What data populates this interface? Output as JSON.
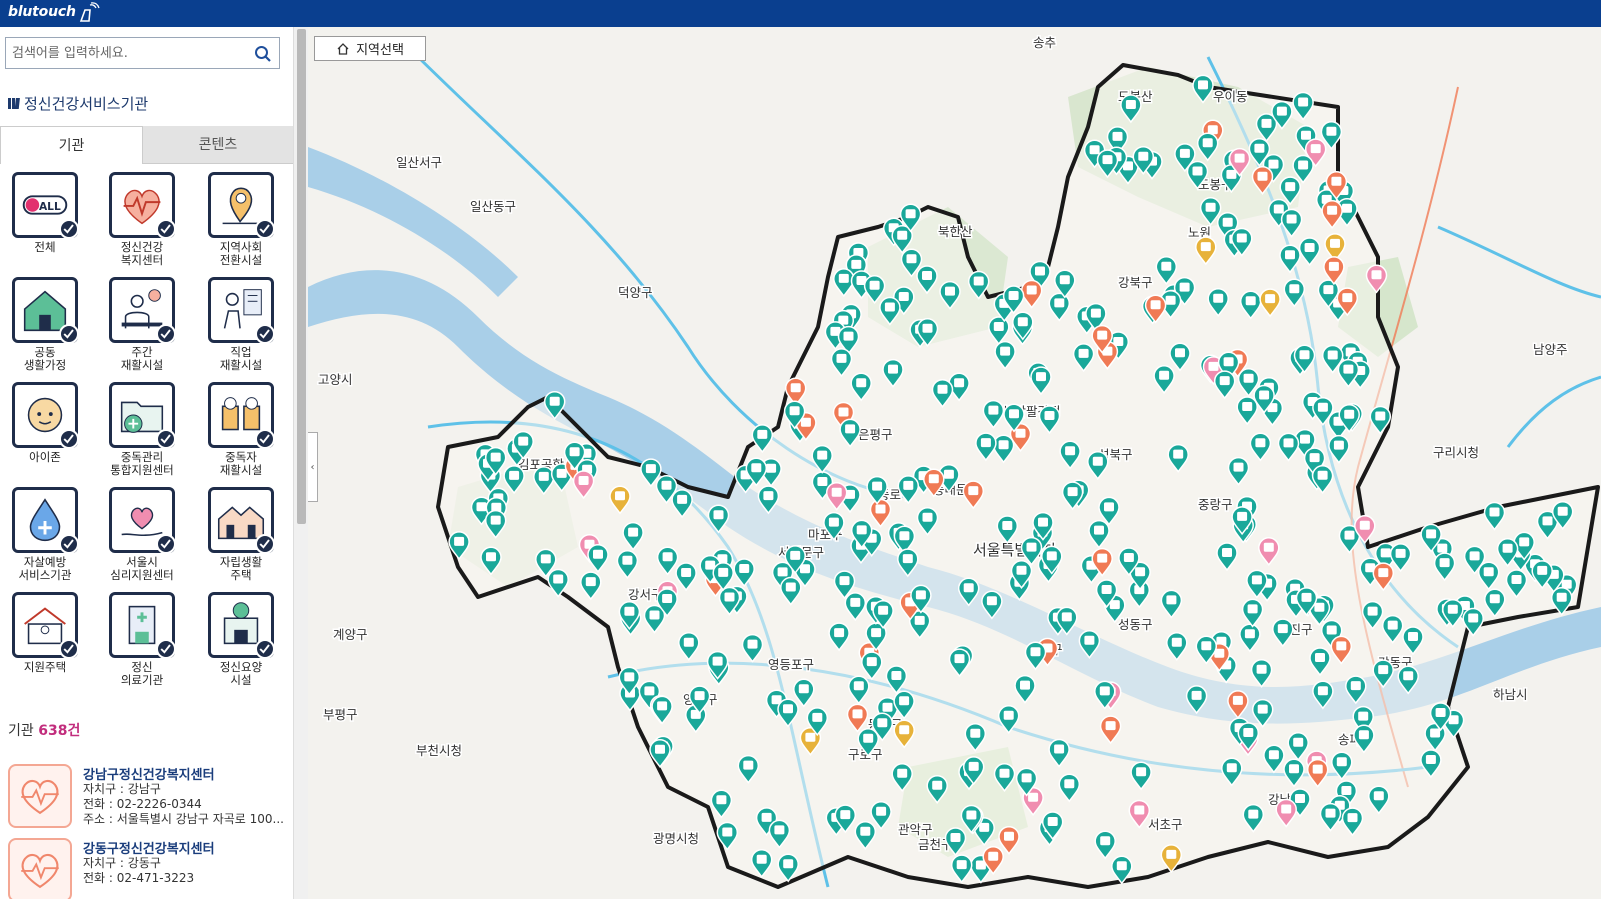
{
  "app": {
    "brand": "blutouch"
  },
  "search": {
    "placeholder": "검색어를 입력하세요."
  },
  "section": {
    "title": "정신건강서비스기관"
  },
  "tabs": [
    {
      "label": "기관"
    },
    {
      "label": "콘텐츠"
    }
  ],
  "categories": [
    {
      "label": "전체",
      "icon": "all-icon"
    },
    {
      "label": "정신건강\n복지센터",
      "icon": "heart-pulse-icon"
    },
    {
      "label": "지역사회\n전환시설",
      "icon": "map-pin-icon"
    },
    {
      "label": "공동\n생활가정",
      "icon": "house-icon"
    },
    {
      "label": "주간\n재활시설",
      "icon": "desk-person-icon"
    },
    {
      "label": "직업\n재활시설",
      "icon": "worker-icon"
    },
    {
      "label": "아이존",
      "icon": "child-icon"
    },
    {
      "label": "중독관리\n통합지원센터",
      "icon": "folder-plus-icon"
    },
    {
      "label": "중독자\n재활시설",
      "icon": "beer-icon"
    },
    {
      "label": "자살예방\n서비스기관",
      "icon": "drop-cross-icon"
    },
    {
      "label": "서울시\n심리지원센터",
      "icon": "hand-heart-icon"
    },
    {
      "label": "자립생활\n주택",
      "icon": "townhouse-icon"
    },
    {
      "label": "지원주택",
      "icon": "support-house-icon"
    },
    {
      "label": "정신\n의료기관",
      "icon": "hospital-icon"
    },
    {
      "label": "정신요양\n시설",
      "icon": "care-facility-icon"
    }
  ],
  "results": {
    "label": "기관",
    "count": "638건",
    "items": [
      {
        "name": "강남구정신건강복지센터",
        "district": "자치구 : 강남구",
        "phone": "전화 : 02-2226-0344",
        "address": "주소 : 서울특별시 강남구 자곡로 100..."
      },
      {
        "name": "강동구정신건강복지센터",
        "district": "자치구 : 강동구",
        "phone": "전화 : 02-471-3223",
        "address": ""
      }
    ]
  },
  "map": {
    "region_button": "지역선택",
    "collapse_label": "‹",
    "labels": [
      "일산서구",
      "일산동구",
      "덕양구",
      "고양시",
      "송추",
      "우이동",
      "도봉산",
      "노원",
      "도봉구",
      "강북구",
      "북한산",
      "은평구",
      "종로구",
      "성북구",
      "중랑구",
      "동대문구",
      "서대문구",
      "마포구",
      "서울특별시청",
      "용산구",
      "성동구",
      "광진구",
      "강동구",
      "강서구",
      "양천구",
      "영등포구",
      "동작구",
      "관악구",
      "서초구",
      "강남구",
      "송파구",
      "구로구",
      "금천구",
      "계양구",
      "부천시청",
      "광명시청",
      "구리시청",
      "김포공항",
      "부평구",
      "북악팔각정",
      "남양주",
      "하남시"
    ],
    "colors": {
      "water": "#a9cfe8",
      "park": "#cfe3c1",
      "boundary": "#1a1a1a",
      "marker_teal": "#1aa89a",
      "marker_orange": "#f07a55",
      "marker_pink": "#f08db0",
      "marker_gold": "#e7b23a",
      "road": "#5ec1e8"
    }
  }
}
